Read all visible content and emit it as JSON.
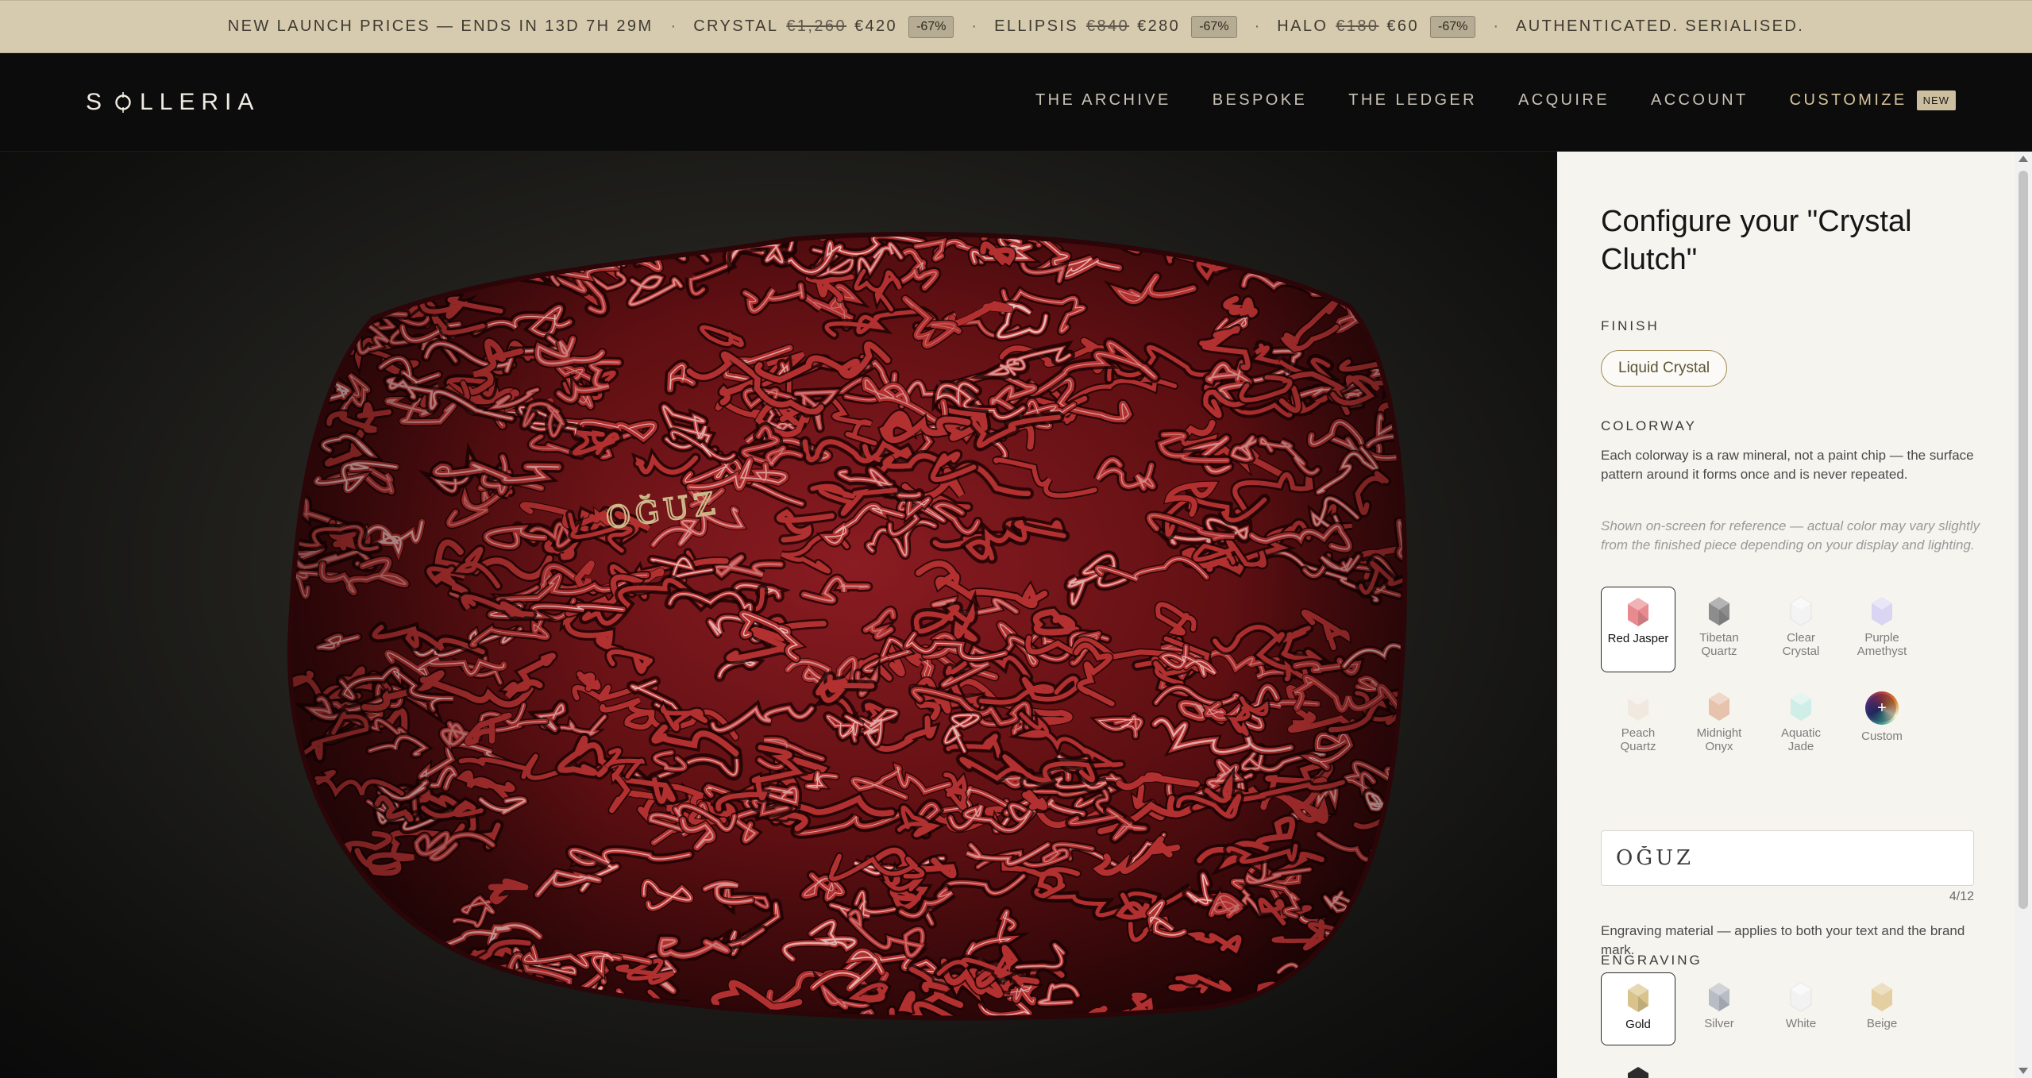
{
  "promo": {
    "lead": "NEW LAUNCH PRICES — ENDS IN 13D 7H 29M",
    "items": [
      {
        "name": "CRYSTAL",
        "old": "€1,260",
        "new": "€420",
        "badge": "-67%"
      },
      {
        "name": "ELLIPSIS",
        "old": "€840",
        "new": "€280",
        "badge": "-67%"
      },
      {
        "name": "HALO",
        "old": "€180",
        "new": "€60",
        "badge": "-67%"
      }
    ],
    "tail": "AUTHENTICATED. SERIALISED.",
    "separator": "·"
  },
  "nav": {
    "logo_pre": "S",
    "logo_post": "LLERIA",
    "links": [
      "THE ARCHIVE",
      "BESPOKE",
      "THE LEDGER",
      "ACQUIRE",
      "ACCOUNT"
    ],
    "customize": "CUSTOMIZE",
    "new_badge": "NEW"
  },
  "viewer": {
    "engraving_text": "OĞUZ",
    "colors": {
      "base": "#5e0f12",
      "ridge": "#b23030",
      "highlight": "#f0d7d2",
      "engraving": "#cdb98a"
    }
  },
  "panel": {
    "title": "Configure your \"Crystal Clutch\"",
    "finish_label": "FINISH",
    "finish_value": "Liquid Crystal",
    "colorway_label": "COLORWAY",
    "colorway_desc": "Each colorway is a raw mineral, not a paint chip — the surface pattern around it forms once and is never repeated.",
    "colorway_note": "Shown on-screen for reference — actual color may vary slightly from the finished piece depending on your display and lighting.",
    "colorways": [
      {
        "name": "Red Jasper",
        "color": "#e98a90",
        "icon": "red-jasper-gem-icon"
      },
      {
        "name": "Tibetan Quartz",
        "color": "#8d8d8d",
        "icon": "tibetan-quartz-gem-icon"
      },
      {
        "name": "Clear Crystal",
        "color": "#f3f3f3",
        "icon": "clear-crystal-gem-icon"
      },
      {
        "name": "Purple Amethyst",
        "color": "#d9d5f2",
        "icon": "purple-amethyst-gem-icon"
      },
      {
        "name": "Peach Quartz",
        "color": "#f1e8e0",
        "icon": "peach-quartz-gem-icon"
      },
      {
        "name": "Midnight Onyx",
        "color": "#e7c3ad",
        "icon": "midnight-onyx-gem-icon"
      },
      {
        "name": "Aquatic Jade",
        "color": "#cfeee8",
        "icon": "aquatic-jade-gem-icon"
      },
      {
        "name": "Custom",
        "color": "#3a3a66",
        "icon": "custom-color-icon"
      }
    ],
    "selected_colorway": "Red Jasper",
    "engraving_label": "ENGRAVING",
    "engraving_value": "OĞUZ",
    "engraving_count": "4/12",
    "material_desc": "Engraving material — applies to both your text and the brand mark.",
    "materials": [
      {
        "name": "Gold",
        "color": "#d9c38a",
        "icon": "gold-gem-icon"
      },
      {
        "name": "Silver",
        "color": "#b8bcc4",
        "icon": "silver-gem-icon"
      },
      {
        "name": "White",
        "color": "#f2f2f2",
        "icon": "white-gem-icon"
      },
      {
        "name": "Beige",
        "color": "#e4cfa2",
        "icon": "beige-gem-icon"
      }
    ],
    "selected_material": "Gold"
  }
}
